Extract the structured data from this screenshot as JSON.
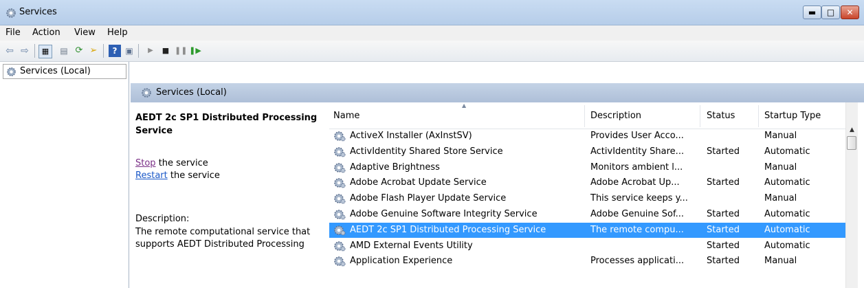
{
  "window": {
    "title": "Services"
  },
  "menu": [
    "File",
    "Action",
    "View",
    "Help"
  ],
  "tree": {
    "root_label": "Services (Local)"
  },
  "pane": {
    "header": "Services (Local)"
  },
  "extended": {
    "service_title": "AEDT 2c SP1 Distributed Processing Service",
    "stop_link": "Stop",
    "stop_suffix": " the service",
    "restart_link": "Restart",
    "restart_suffix": " the service",
    "description_label": "Description:",
    "description": "The remote computational service that supports AEDT Distributed Processing"
  },
  "list": {
    "columns": [
      "Name",
      "Description",
      "Status",
      "Startup Type"
    ],
    "sorted_column": "Name",
    "rows": [
      {
        "name": "ActiveX Installer (AxInstSV)",
        "description": "Provides User Acco...",
        "status": "",
        "startup": "Manual"
      },
      {
        "name": "ActivIdentity Shared Store Service",
        "description": "ActivIdentity Share...",
        "status": "Started",
        "startup": "Automatic"
      },
      {
        "name": "Adaptive Brightness",
        "description": "Monitors ambient l...",
        "status": "",
        "startup": "Manual"
      },
      {
        "name": "Adobe Acrobat Update Service",
        "description": "Adobe Acrobat Up...",
        "status": "Started",
        "startup": "Automatic"
      },
      {
        "name": "Adobe Flash Player Update Service",
        "description": "This service keeps y...",
        "status": "",
        "startup": "Manual"
      },
      {
        "name": "Adobe Genuine Software Integrity Service",
        "description": "Adobe Genuine Sof...",
        "status": "Started",
        "startup": "Automatic"
      },
      {
        "name": "AEDT 2c SP1 Distributed Processing Service",
        "description": "The remote compu...",
        "status": "Started",
        "startup": "Automatic",
        "selected": true
      },
      {
        "name": "AMD External Events Utility",
        "description": "",
        "status": "Started",
        "startup": "Automatic"
      },
      {
        "name": "Application Experience",
        "description": "Processes applicati...",
        "status": "Started",
        "startup": "Manual"
      }
    ]
  },
  "icons": {
    "title": "services-gear-icon",
    "toolbar": [
      "back-arrow-icon",
      "forward-arrow-icon",
      "show-hide-console-tree-icon",
      "properties-icon",
      "refresh-icon",
      "export-list-icon",
      "help-icon",
      "action-pane-icon",
      "start-service-icon",
      "stop-service-icon",
      "pause-service-icon",
      "restart-service-icon"
    ]
  },
  "colors": {
    "selection": "#3399ff",
    "link": "#1a58c8",
    "visited_link": "#7a2f86",
    "header_bg": "#b8c9e0"
  }
}
